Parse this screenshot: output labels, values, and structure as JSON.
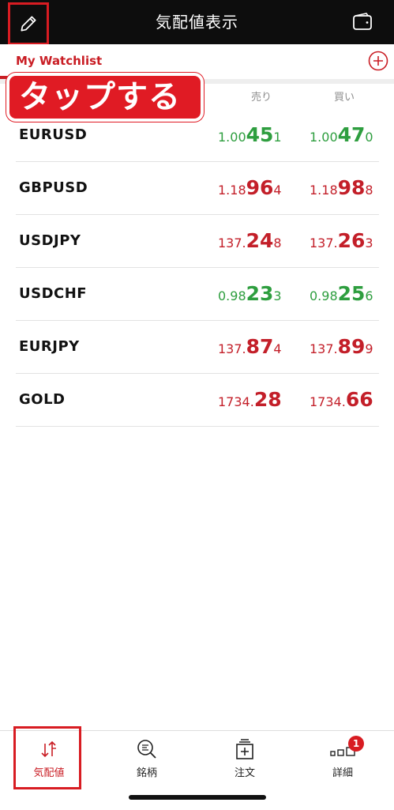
{
  "header": {
    "title": "気配値表示",
    "edit_icon": "pencil-icon",
    "wallet_icon": "wallet-icon"
  },
  "watchlist": {
    "title": "My Watchlist",
    "add_icon": "plus-circle-icon"
  },
  "callout": {
    "text": "タップする"
  },
  "columns": {
    "sell": "売り",
    "buy": "買い"
  },
  "quotes": [
    {
      "symbol": "EURUSD",
      "direction": "up",
      "sell": {
        "small": "1.00",
        "big": "45",
        "tail": "1"
      },
      "buy": {
        "small": "1.00",
        "big": "47",
        "tail": "0"
      }
    },
    {
      "symbol": "GBPUSD",
      "direction": "down",
      "sell": {
        "small": "1.18",
        "big": "96",
        "tail": "4"
      },
      "buy": {
        "small": "1.18",
        "big": "98",
        "tail": "8"
      }
    },
    {
      "symbol": "USDJPY",
      "direction": "down",
      "sell": {
        "small": "137.",
        "big": "24",
        "tail": "8"
      },
      "buy": {
        "small": "137.",
        "big": "26",
        "tail": "3"
      }
    },
    {
      "symbol": "USDCHF",
      "direction": "up",
      "sell": {
        "small": "0.98",
        "big": "23",
        "tail": "3"
      },
      "buy": {
        "small": "0.98",
        "big": "25",
        "tail": "6"
      }
    },
    {
      "symbol": "EURJPY",
      "direction": "down",
      "sell": {
        "small": "137.",
        "big": "87",
        "tail": "4"
      },
      "buy": {
        "small": "137.",
        "big": "89",
        "tail": "9"
      }
    },
    {
      "symbol": "GOLD",
      "direction": "down",
      "sell": {
        "small": "1734.",
        "big": "28",
        "tail": ""
      },
      "buy": {
        "small": "1734.",
        "big": "66",
        "tail": ""
      }
    }
  ],
  "colors": {
    "up": "#2e9e3f",
    "down": "#c31f29",
    "accent": "#c91d24",
    "highlight_box": "#d81c22"
  },
  "bottom_nav": [
    {
      "label": "気配値",
      "icon": "quotes-arrows-icon",
      "active": true
    },
    {
      "label": "銘柄",
      "icon": "symbol-search-icon",
      "active": false
    },
    {
      "label": "注文",
      "icon": "order-icon",
      "active": false
    },
    {
      "label": "詳細",
      "icon": "details-icon",
      "active": false,
      "badge": "1"
    }
  ]
}
